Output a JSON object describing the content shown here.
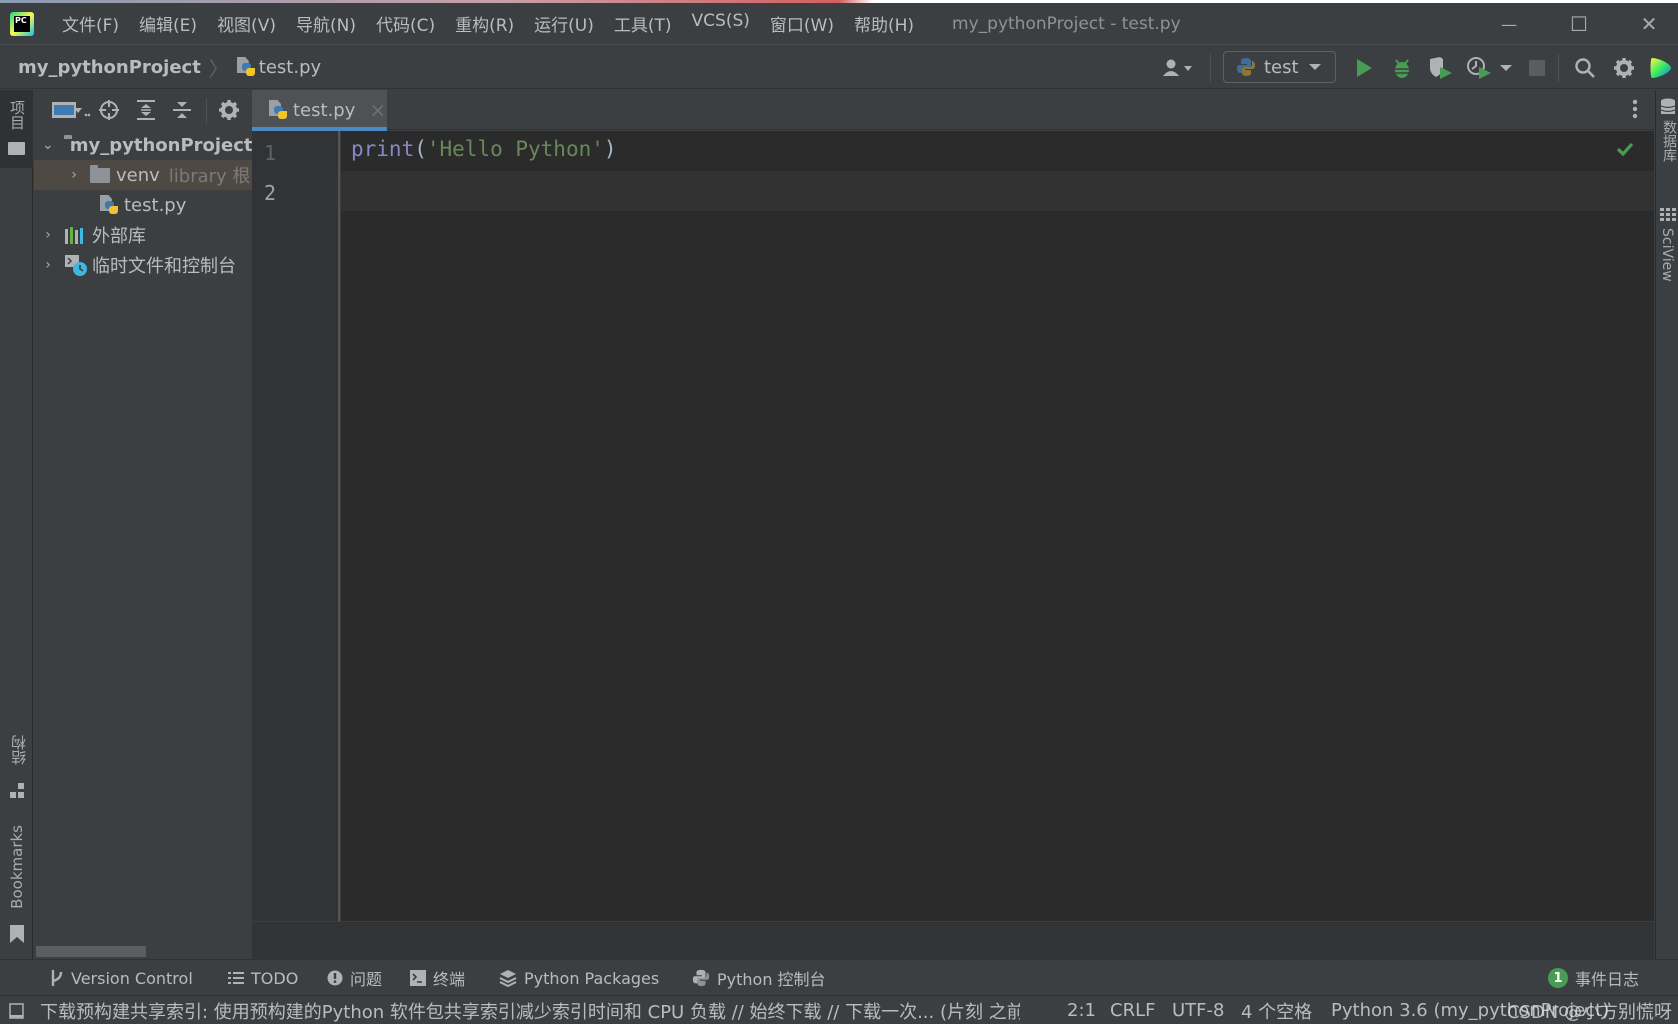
{
  "window": {
    "title": "my_pythonProject - test.py",
    "logo_text": "PC",
    "minimize_glyph": "—",
    "maximize_glyph": "☐",
    "close_glyph": "✕"
  },
  "menu": [
    {
      "label": "文件(F)"
    },
    {
      "label": "编辑(E)"
    },
    {
      "label": "视图(V)"
    },
    {
      "label": "导航(N)"
    },
    {
      "label": "代码(C)"
    },
    {
      "label": "重构(R)"
    },
    {
      "label": "运行(U)"
    },
    {
      "label": "工具(T)"
    },
    {
      "label": "VCS(S)"
    },
    {
      "label": "窗口(W)"
    },
    {
      "label": "帮助(H)"
    }
  ],
  "navbar": {
    "project": "my_pythonProject",
    "separator": "〉",
    "file": "test.py"
  },
  "toolbar": {
    "run_config": "test",
    "icons": [
      "user-icon",
      "run-icon",
      "debug-icon",
      "coverage-icon",
      "profile-icon",
      "stop-icon",
      "search-icon",
      "settings-icon",
      "toolbox-icon"
    ]
  },
  "left_strip": {
    "project_label": "项目",
    "structure_label": "结构",
    "bookmarks_label": "Bookmarks"
  },
  "right_strip": {
    "database_label": "数据库",
    "sciview_label": "SciView"
  },
  "project_tree": [
    {
      "label": "my_pythonProject",
      "kind": "folder",
      "expanded": true,
      "bold": true
    },
    {
      "label": "venv",
      "hint": "library 根",
      "kind": "folder",
      "expanded": false,
      "selected": true
    },
    {
      "label": "test.py",
      "kind": "python-file"
    },
    {
      "label": "外部库",
      "kind": "library",
      "expanded": false
    },
    {
      "label": "临时文件和控制台",
      "kind": "scratches",
      "expanded": false
    }
  ],
  "editor": {
    "tab_label": "test.py",
    "tab_close": "×",
    "line_numbers": [
      "1",
      "2"
    ],
    "code": {
      "func": "print",
      "open_paren": "(",
      "string": "'Hello Python'",
      "close_paren": ")"
    },
    "inspection_ok": true
  },
  "tool_windows": [
    {
      "label": "Version Control",
      "icon": "branch-icon"
    },
    {
      "label": "TODO",
      "icon": "list-icon"
    },
    {
      "label": "问题",
      "icon": "problems-icon"
    },
    {
      "label": "终端",
      "icon": "terminal-icon"
    },
    {
      "label": "Python Packages",
      "icon": "packages-icon"
    },
    {
      "label": "Python 控制台",
      "icon": "python-console-icon"
    }
  ],
  "event_log": {
    "count": "1",
    "label": "事件日志"
  },
  "status": {
    "message": "下载预构建共享索引: 使用预构建的Python 软件包共享索引减少索引时间和 CPU 负载 // 始终下载 // 下载一次... (片刻 之前)",
    "position": "2:1",
    "line_sep": "CRLF",
    "encoding": "UTF-8",
    "indent": "4 个空格",
    "interpreter": "Python 3.6 (my_pythonProject)",
    "watermark": "CSDN @小方别慌呀"
  },
  "colors": {
    "accent": "#4a88c7",
    "run_green": "#499c54",
    "keyword": "#8888c6",
    "string": "#6a8759"
  }
}
